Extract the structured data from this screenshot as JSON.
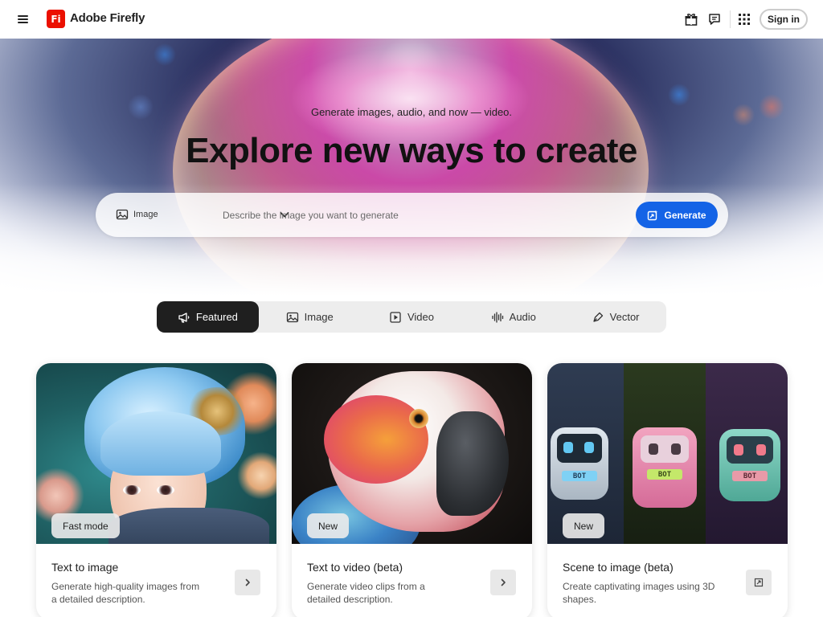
{
  "header": {
    "logo_text": "Fi",
    "brand": "Adobe Firefly",
    "icons": [
      "menu-icon",
      "gift-icon",
      "chat-icon",
      "apps-grid-icon"
    ],
    "sign_in_label": "Sign in"
  },
  "hero": {
    "subtitle": "Generate images, audio, and now — video.",
    "headline": "Explore new ways to create"
  },
  "prompt": {
    "type_label": "Image",
    "placeholder": "Describe the image you want to generate",
    "generate_label": "Generate"
  },
  "tabs": [
    {
      "label": "Featured",
      "active": true,
      "icon": "megaphone-icon"
    },
    {
      "label": "Image",
      "active": false,
      "icon": "image-icon"
    },
    {
      "label": "Video",
      "active": false,
      "icon": "video-icon"
    },
    {
      "label": "Audio",
      "active": false,
      "icon": "audio-wave-icon"
    },
    {
      "label": "Vector",
      "active": false,
      "icon": "pen-icon"
    }
  ],
  "cards": [
    {
      "badge": "Fast mode",
      "title": "Text to image",
      "description": "Generate high-quality images from a detailed description.",
      "action_icon": "chevron-right-icon"
    },
    {
      "badge": "New",
      "title": "Text to video (beta)",
      "description": "Generate video clips from a detailed description.",
      "action_icon": "chevron-right-icon"
    },
    {
      "badge": "New",
      "title": "Scene to image (beta)",
      "description": "Create captivating images using 3D shapes.",
      "action_icon": "open-external-icon"
    }
  ],
  "robot_label": "BOT",
  "colors": {
    "brand_red": "#eb1000",
    "primary_blue": "#1463e6",
    "active_tab": "#1f1f1f"
  }
}
